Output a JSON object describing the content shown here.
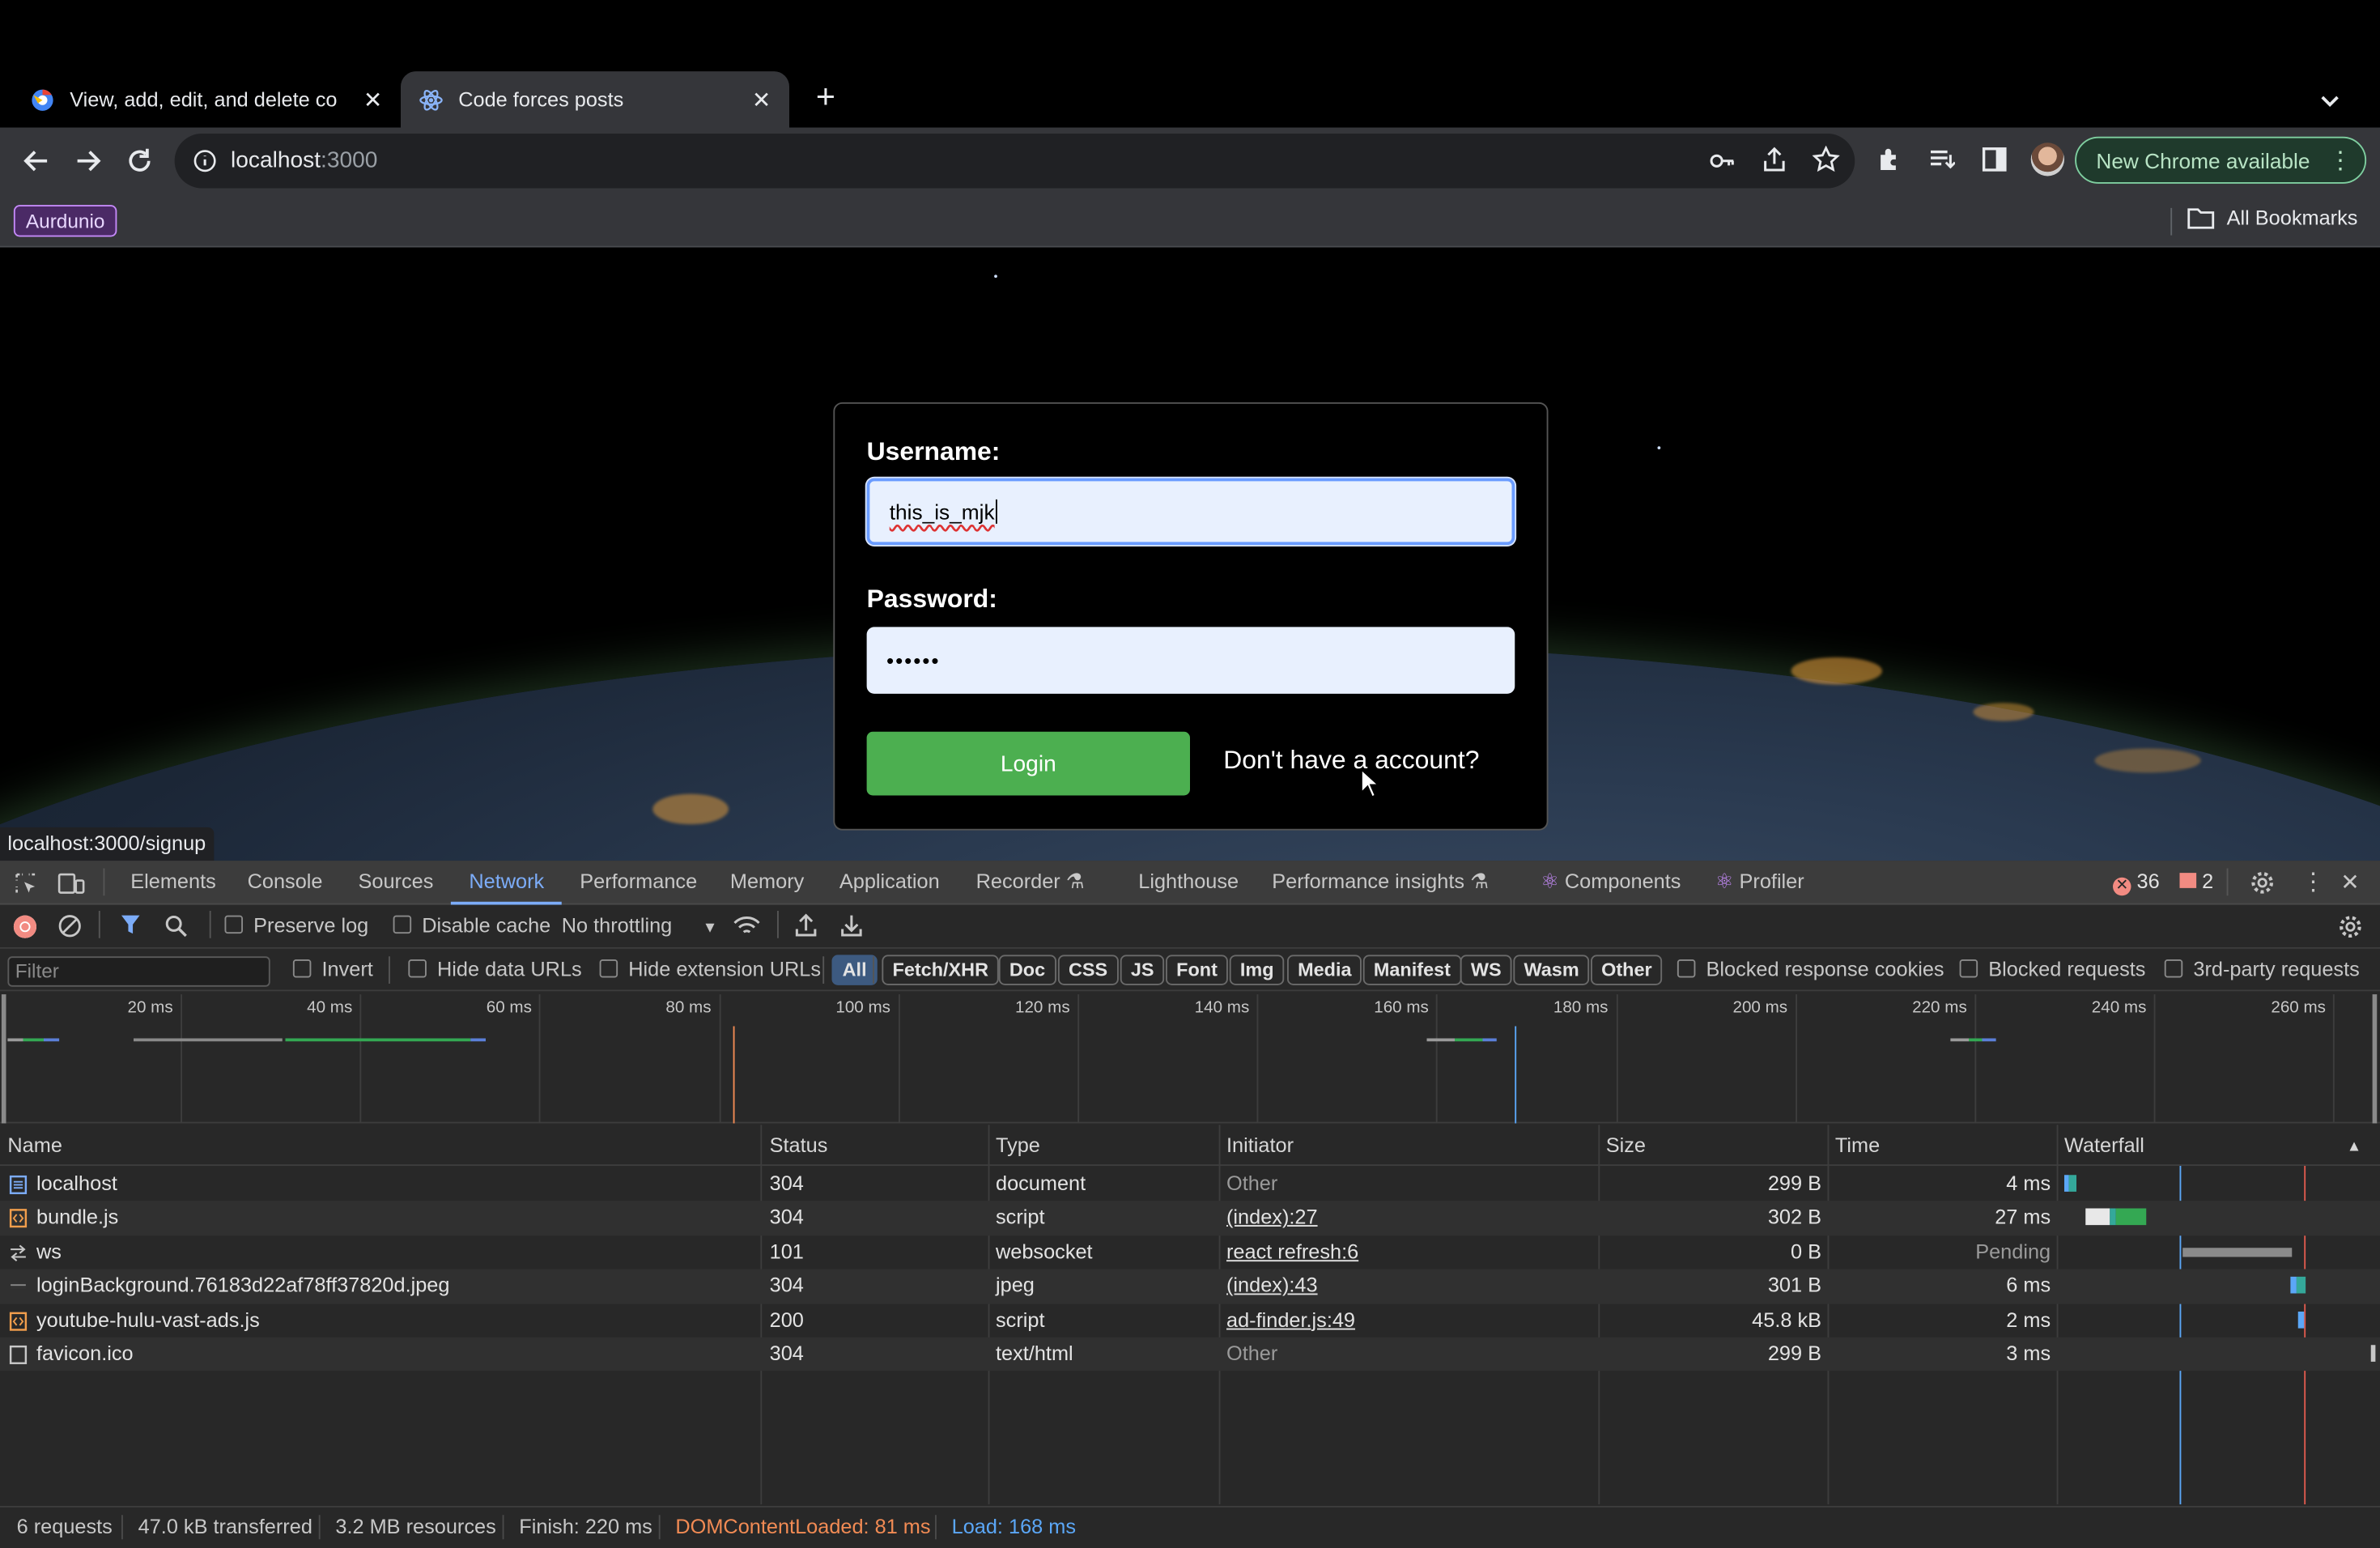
{
  "browser": {
    "tabs": [
      {
        "title": "View, add, edit, and delete co",
        "active": false
      },
      {
        "title": "Code forces posts",
        "active": true
      }
    ],
    "address": {
      "host": "localhost",
      "port": ":3000"
    },
    "update_button": "New Chrome available",
    "bookmark_chip": "Aurdunio",
    "all_bookmarks": "All Bookmarks",
    "status_url": "localhost:3000/signup"
  },
  "login": {
    "username_label": "Username:",
    "username_value": "this_is_mjk",
    "password_label": "Password:",
    "password_value": "••••••",
    "login_button": "Login",
    "signup_link": "Don't have a account?"
  },
  "devtools": {
    "tabs": [
      "Elements",
      "Console",
      "Sources",
      "Network",
      "Performance",
      "Memory",
      "Application",
      "Recorder",
      "Lighthouse",
      "Performance insights",
      "Components",
      "Profiler"
    ],
    "selected_tab": "Network",
    "error_count": "36",
    "issue_count": "2",
    "toolbar": {
      "preserve_log": "Preserve log",
      "disable_cache": "Disable cache",
      "throttling": "No throttling"
    },
    "filter": {
      "placeholder": "Filter",
      "invert": "Invert",
      "hide_data_urls": "Hide data URLs",
      "hide_extension_urls": "Hide extension URLs",
      "types": [
        "All",
        "Fetch/XHR",
        "Doc",
        "CSS",
        "JS",
        "Font",
        "Img",
        "Media",
        "Manifest",
        "WS",
        "Wasm",
        "Other"
      ],
      "selected_type": "All",
      "blocked_cookies": "Blocked response cookies",
      "blocked_requests": "Blocked requests",
      "third_party": "3rd-party requests"
    },
    "timeline_ticks": [
      "20 ms",
      "40 ms",
      "60 ms",
      "80 ms",
      "100 ms",
      "120 ms",
      "140 ms",
      "160 ms",
      "180 ms",
      "200 ms",
      "220 ms",
      "240 ms",
      "260 ms"
    ],
    "columns": [
      "Name",
      "Status",
      "Type",
      "Initiator",
      "Size",
      "Time",
      "Waterfall"
    ],
    "requests": [
      {
        "name": "localhost",
        "status": "304",
        "type": "document",
        "initiator": "Other",
        "size": "299 B",
        "time": "4 ms",
        "icon": "document-icon"
      },
      {
        "name": "bundle.js",
        "status": "304",
        "type": "script",
        "initiator": "(index):27",
        "size": "302 B",
        "time": "27 ms",
        "icon": "script-icon"
      },
      {
        "name": "ws",
        "status": "101",
        "type": "websocket",
        "initiator": "react refresh:6",
        "size": "0 B",
        "time": "Pending",
        "icon": "websocket-icon"
      },
      {
        "name": "loginBackground.76183d22af78ff37820d.jpeg",
        "status": "304",
        "type": "jpeg",
        "initiator": "(index):43",
        "size": "301 B",
        "time": "6 ms",
        "icon": "image-icon"
      },
      {
        "name": "youtube-hulu-vast-ads.js",
        "status": "200",
        "type": "script",
        "initiator": "ad-finder.js:49",
        "size": "45.8 kB",
        "time": "2 ms",
        "icon": "script-icon"
      },
      {
        "name": "favicon.ico",
        "status": "304",
        "type": "text/html",
        "initiator": "Other",
        "size": "299 B",
        "time": "3 ms",
        "icon": "file-icon"
      }
    ],
    "summary": {
      "requests": "6 requests",
      "transferred": "47.0 kB transferred",
      "resources": "3.2 MB resources",
      "finish": "Finish: 220 ms",
      "dom_content_loaded": "DOMContentLoaded: 81 ms",
      "load": "Load: 168 ms"
    },
    "colors": {
      "accent": "#7cacf8",
      "dcl": "#f28b54",
      "load": "#5ba7f7",
      "error": "#f28b82"
    }
  }
}
